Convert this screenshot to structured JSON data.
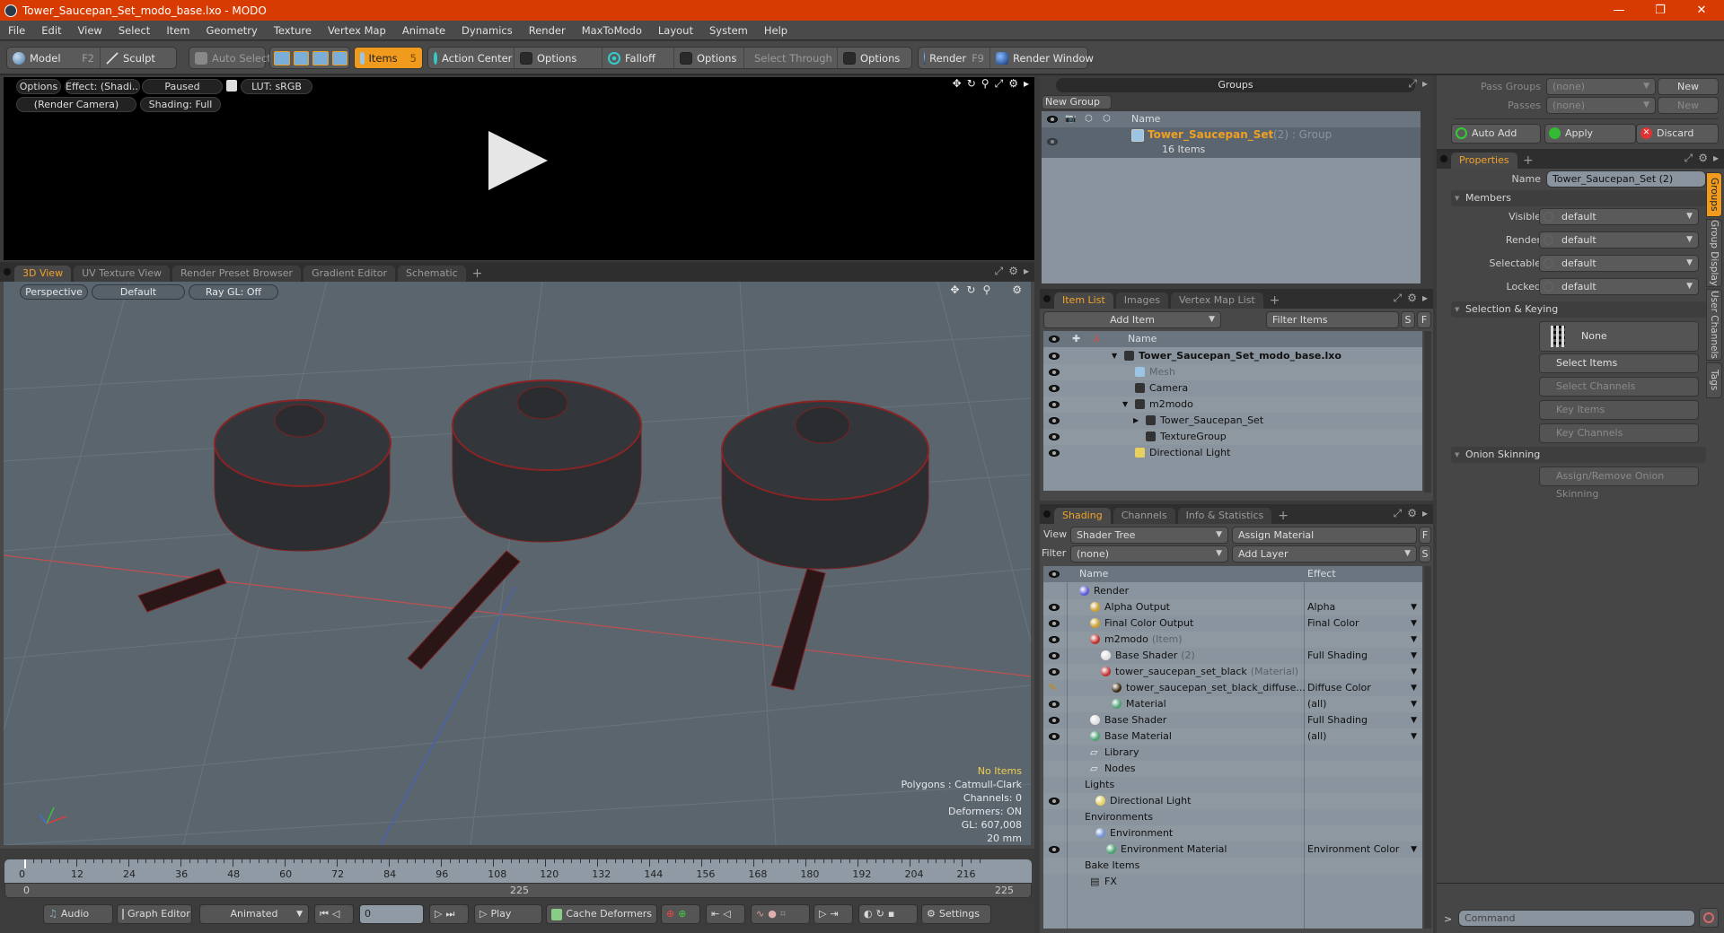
{
  "window": {
    "title": "Tower_Saucepan_Set_modo_base.lxo - MODO",
    "controls": [
      "minimize",
      "restore",
      "close"
    ]
  },
  "menu": [
    "File",
    "Edit",
    "View",
    "Select",
    "Item",
    "Geometry",
    "Texture",
    "Vertex Map",
    "Animate",
    "Dynamics",
    "Render",
    "MaxToModo",
    "Layout",
    "System",
    "Help"
  ],
  "toolbar": {
    "model": "Model",
    "model_key": "F2",
    "sculpt": "Sculpt",
    "auto_select": "Auto Select",
    "items": "Items",
    "items_key": "5",
    "action_center": "Action Center",
    "options1": "Options",
    "falloff": "Falloff",
    "options2": "Options",
    "select_through": "Select Through",
    "options3": "Options",
    "render": "Render",
    "render_key": "F9",
    "render_window": "Render Window"
  },
  "render_view": {
    "options": "Options",
    "effect": "Effect: (Shadi...",
    "status": "Paused",
    "lut": "LUT: sRGB",
    "camera": "(Render Camera)",
    "shading": "Shading: Full"
  },
  "viewport": {
    "tabs": [
      "3D View",
      "UV Texture View",
      "Render Preset Browser",
      "Gradient Editor",
      "Schematic"
    ],
    "active_tab": "3D View",
    "projection": "Perspective",
    "style": "Default",
    "raygl": "Ray GL: Off",
    "info": {
      "selection": "No Items",
      "polygons": "Polygons : Catmull-Clark",
      "channels": "Channels: 0",
      "deformers": "Deformers: ON",
      "gl": "GL: 607,008",
      "scale": "20 mm"
    }
  },
  "groups": {
    "title": "Groups",
    "new_group": "New Group",
    "col_name": "Name",
    "rows": [
      {
        "name": "Tower_Saucepan_Set",
        "count": "(2)",
        "type": ": Group",
        "sub": "16 Items"
      }
    ]
  },
  "passes": {
    "pass_groups_label": "Pass Groups",
    "pass_groups_value": "(none)",
    "passes_label": "Passes",
    "passes_value": "(none)",
    "new": "New",
    "auto_add": "Auto Add",
    "apply": "Apply",
    "discard": "Discard"
  },
  "properties": {
    "tab": "Properties",
    "name_label": "Name",
    "name_value": "Tower_Saucepan_Set (2)",
    "members": "Members",
    "fields": [
      {
        "label": "Visible",
        "value": "default"
      },
      {
        "label": "Render",
        "value": "default"
      },
      {
        "label": "Selectable",
        "value": "default"
      },
      {
        "label": "Locked",
        "value": "default"
      }
    ],
    "selection_keying": "Selection & Keying",
    "none_btn": "None",
    "select_items": "Select Items",
    "select_channels": "Select Channels",
    "key_items": "Key Items",
    "key_channels": "Key Channels",
    "onion": "Onion Skinning",
    "onion_btn": "Assign/Remove Onion Skinning",
    "side_tabs": [
      "Groups",
      "Group Display",
      "User Channels",
      "Tags"
    ]
  },
  "item_list": {
    "tabs": [
      "Item List",
      "Images",
      "Vertex Map List"
    ],
    "add_item": "Add Item",
    "filter": "Filter Items",
    "s": "S",
    "f": "F",
    "col_name": "Name",
    "rows": [
      {
        "name": "Tower_Saucepan_Set_modo_base.lxo",
        "depth": 0,
        "bold": true
      },
      {
        "name": "Mesh",
        "depth": 1,
        "dim": true
      },
      {
        "name": "Camera",
        "depth": 1
      },
      {
        "name": "m2modo",
        "depth": 1
      },
      {
        "name": "Tower_Saucepan_Set",
        "depth": 2
      },
      {
        "name": "TextureGroup",
        "depth": 2
      },
      {
        "name": "Directional Light",
        "depth": 1
      }
    ]
  },
  "shading": {
    "tabs": [
      "Shading",
      "Channels",
      "Info & Statistics"
    ],
    "view_label": "View",
    "view_value": "Shader Tree",
    "assign_material": "Assign Material",
    "filter_label": "Filter",
    "filter_value": "(none)",
    "add_layer": "Add Layer",
    "col_name": "Name",
    "col_effect": "Effect",
    "rows": [
      {
        "name": "Render",
        "suffix": "",
        "effect": "",
        "depth": 0,
        "eye": false,
        "icon": "#5a5ad8"
      },
      {
        "name": "Alpha Output",
        "suffix": "",
        "effect": "Alpha",
        "depth": 1,
        "eye": true,
        "icon": "#c9a030"
      },
      {
        "name": "Final Color Output",
        "suffix": "",
        "effect": "Final Color",
        "depth": 1,
        "eye": true,
        "icon": "#c9a030"
      },
      {
        "name": "m2modo",
        "suffix": "(Item)",
        "effect": "",
        "depth": 1,
        "eye": true,
        "icon": "#c03030"
      },
      {
        "name": "Base Shader",
        "suffix": "(2)",
        "effect": "Full Shading",
        "depth": 2,
        "eye": true,
        "icon": "#e0e0e0"
      },
      {
        "name": "tower_saucepan_set_black",
        "suffix": "(Material)",
        "effect": "",
        "depth": 2,
        "eye": true,
        "icon": "#c03030"
      },
      {
        "name": "tower_saucepan_set_black_diffuse...",
        "suffix": "",
        "effect": "Diffuse Color",
        "depth": 3,
        "eye": false,
        "icon": "#3a2a10"
      },
      {
        "name": "Material",
        "suffix": "",
        "effect": "(all)",
        "depth": 3,
        "eye": true,
        "icon": "#4aa070"
      },
      {
        "name": "Base Shader",
        "suffix": "",
        "effect": "Full Shading",
        "depth": 1,
        "eye": true,
        "icon": "#e0e0e0"
      },
      {
        "name": "Base Material",
        "suffix": "",
        "effect": "(all)",
        "depth": 1,
        "eye": true,
        "icon": "#4aa070"
      },
      {
        "name": "Library",
        "suffix": "",
        "effect": "",
        "depth": 1,
        "eye": false,
        "icon": "folder"
      },
      {
        "name": "Nodes",
        "suffix": "",
        "effect": "",
        "depth": 1,
        "eye": false,
        "icon": "folder"
      },
      {
        "name": "Lights",
        "suffix": "",
        "effect": "",
        "depth": 0.5,
        "eye": false,
        "icon": ""
      },
      {
        "name": "Directional Light",
        "suffix": "",
        "effect": "",
        "depth": 1.5,
        "eye": true,
        "icon": "#e8d060"
      },
      {
        "name": "Environments",
        "suffix": "",
        "effect": "",
        "depth": 0.5,
        "eye": false,
        "icon": ""
      },
      {
        "name": "Environment",
        "suffix": "",
        "effect": "",
        "depth": 1.5,
        "eye": false,
        "icon": "#7090d0"
      },
      {
        "name": "Environment Material",
        "suffix": "",
        "effect": "Environment Color",
        "depth": 2.5,
        "eye": true,
        "icon": "#4aa070"
      },
      {
        "name": "Bake Items",
        "suffix": "",
        "effect": "",
        "depth": 0.5,
        "eye": false,
        "icon": ""
      },
      {
        "name": "FX",
        "suffix": "",
        "effect": "",
        "depth": 1,
        "eye": false,
        "icon": "clap"
      }
    ]
  },
  "timeline": {
    "ticks": [
      "0",
      "12",
      "24",
      "36",
      "48",
      "60",
      "72",
      "84",
      "96",
      "108",
      "120",
      "132",
      "144",
      "156",
      "168",
      "180",
      "192",
      "204",
      "216"
    ],
    "range_start": "0",
    "range_mid": "225",
    "range_end": "225"
  },
  "transport": {
    "audio": "Audio",
    "graph_editor": "Graph Editor",
    "mode": "Animated",
    "frame": "0",
    "play": "Play",
    "cache_deformers": "Cache Deformers",
    "settings": "Settings"
  },
  "command": {
    "prompt": ">",
    "placeholder": "Command"
  },
  "colors": {
    "accent": "#f09a1e",
    "titlebar": "#d83b01",
    "viewport": "#5b656e",
    "list_bg": "#8a949e"
  }
}
